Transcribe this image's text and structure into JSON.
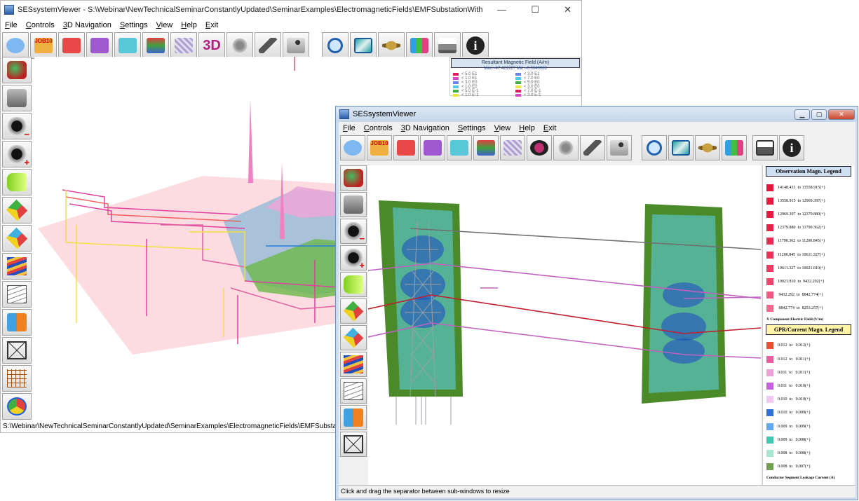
{
  "win1": {
    "title": "SESsystemViewer - S:\\Webinar\\NewTechnicalSeminarConstantlyUpdated\\SeminarExamples\\ElectromagneticFields\\EMFSubstationWithTransformer\\HI_EMFSubstati...",
    "buttons": {
      "minimize": "—",
      "maximize": "☐",
      "close": "✕"
    },
    "menu": [
      "File",
      "Controls",
      "3D Navigation",
      "Settings",
      "View",
      "Help",
      "Exit"
    ],
    "status": "S:\\Webinar\\NewTechnicalSeminarConstantlyUpdated\\SeminarExamples\\ElectromagneticFields\\EMFSubstationW",
    "legend": {
      "title": "Resultant Magnetic Field (A/m)",
      "max_min": "Max.=47.421927     Min.=0.0040083",
      "rows": [
        [
          "< 5.0 E1",
          "< 3.0 E1"
        ],
        [
          "< 1.0 E1",
          "< 7.0 E0"
        ],
        [
          "< 3.0 E0",
          "< 5.0 E0"
        ],
        [
          "< 1.0 E0",
          "< 3.0 E0"
        ],
        [
          "< 5.0 E-1",
          "< 7.0 E-1"
        ],
        [
          "< 1.0 E-1",
          "< 3.0 E-1"
        ]
      ],
      "colors": [
        "#e8185c",
        "#d848c8",
        "#6a84e8",
        "#58c8e8",
        "#40b040",
        "#e8e840"
      ]
    }
  },
  "win2": {
    "title": "SESsystemViewer",
    "menu": [
      "File",
      "Controls",
      "3D Navigation",
      "Settings",
      "View",
      "Help",
      "Exit"
    ],
    "status": "Click and drag the separator between sub-windows to resize",
    "obs_legend": {
      "title": "Observation Magn. Legend",
      "rows": [
        "14148.433  to 13558.915(+)",
        "13558.915  to 12969.397(+)",
        "12969.397  to 12379.880(+)",
        "12379.880  to 11790.362(+)",
        "11790.362  to 11200.845(+)",
        "11200.845  to 10611.327(+)",
        "10611.327  to 10021.810(+)",
        "10021.810  to  9432.292(+)",
        " 9432.292  to  8842.774(+)",
        " 8842.774  to  8253.257(+)"
      ],
      "colors": [
        "#e8163c",
        "#e8183e",
        "#e81a44",
        "#ea2048",
        "#ea2a52",
        "#ec305a",
        "#ee3a64",
        "#f0466e",
        "#f25880",
        "#f46a90"
      ],
      "note": "X Component Electric Field (V/m)"
    },
    "gpr_legend": {
      "title": "GPR/Current Magn. Legend",
      "rows": [
        "0.012  to   0.012(+)",
        "0.012  to   0.011(+)",
        "0.011  to   0.011(+)",
        "0.011  to   0.010(+)",
        "0.010  to   0.010(+)",
        "0.010  to   0.009(+)",
        "0.009  to   0.009(+)",
        "0.009  to   0.008(+)",
        "0.008  to   0.008(+)",
        "0.008  to   0.007(+)"
      ],
      "colors": [
        "#e85030",
        "#e860a0",
        "#f0a0d8",
        "#c860e0",
        "#f0c8f0",
        "#3070d8",
        "#60a8f0",
        "#40c8b0",
        "#a8e8d0",
        "#70a050"
      ],
      "note": "Conductor Segment Leakage Current (A)"
    }
  },
  "toolbar_icons": [
    "help-bubble-icon",
    "job-folder-icon",
    "red-folder-icon",
    "purple-folder-icon",
    "cyan-folder-icon",
    "stack-folder-icon",
    "grid-folder-icon",
    "3d-icon",
    "gears-icon",
    "remote-icon",
    "joystick-icon",
    "zoom-icon",
    "fit-icon",
    "saturn-icon",
    "cubes-icon",
    "print-icon",
    "info-icon"
  ],
  "toolbar_label_3d": "3D",
  "toolbar_label_job": "JOB10"
}
